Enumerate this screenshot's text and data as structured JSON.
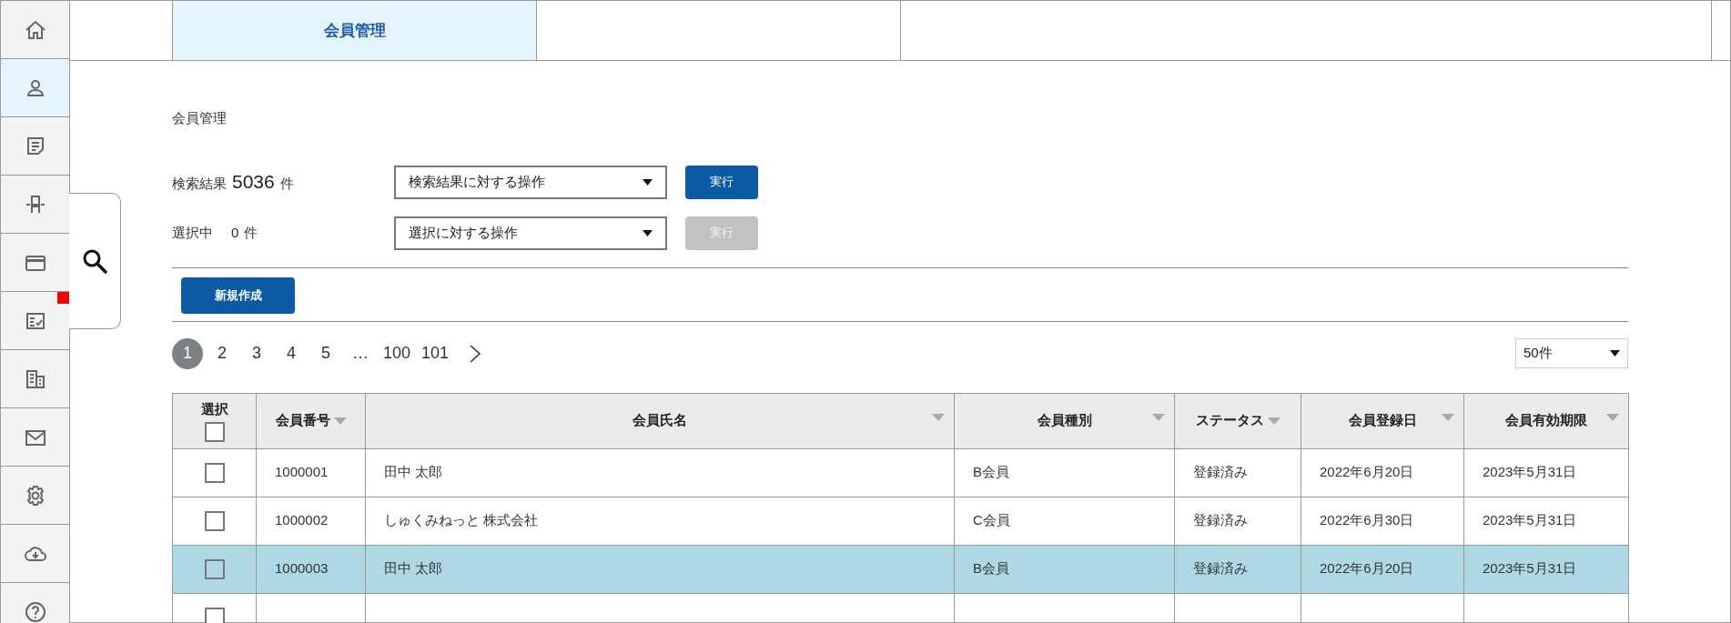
{
  "sidebar": {
    "items": [
      {
        "selected": false,
        "alert": false
      },
      {
        "selected": true,
        "alert": false
      },
      {
        "selected": false,
        "alert": false
      },
      {
        "selected": false,
        "alert": false
      },
      {
        "selected": false,
        "alert": false
      },
      {
        "selected": false,
        "alert": true
      },
      {
        "selected": false,
        "alert": false
      },
      {
        "selected": false,
        "alert": false
      },
      {
        "selected": false,
        "alert": false
      },
      {
        "selected": false,
        "alert": false
      },
      {
        "selected": false,
        "alert": false
      }
    ]
  },
  "tabs": [
    {
      "label": "会員管理",
      "selected": true
    },
    {
      "selected": false
    }
  ],
  "page_title": "会員管理",
  "search_result": {
    "label": "検索結果",
    "count": "5036",
    "unit": "件",
    "operation": "検索結果に対する操作",
    "button": {
      "label": "実行",
      "disabled": false
    }
  },
  "selection": {
    "label": "選択中",
    "count": "0",
    "unit": "件",
    "operation": "選択に対する操作",
    "button": {
      "label": "実行",
      "disabled": true
    }
  },
  "new_button": "新規作成",
  "pagination": {
    "pages": [
      {
        "label": "1",
        "selected": true
      },
      {
        "label": "2",
        "selected": false
      },
      {
        "label": "3",
        "selected": false
      },
      {
        "label": "4",
        "selected": false
      },
      {
        "label": "5",
        "selected": false
      },
      {
        "label": "…",
        "selected": false
      },
      {
        "label": "100",
        "selected": false
      },
      {
        "label": "101",
        "selected": false
      }
    ]
  },
  "page_size": "50件",
  "table": {
    "columns": [
      {
        "label": "選択",
        "sortable": false
      },
      {
        "label": "会員番号",
        "sortable": true
      },
      {
        "label": "会員氏名",
        "sortable": true
      },
      {
        "label": "会員種別",
        "sortable": true
      },
      {
        "label": "ステータス",
        "sortable": true
      },
      {
        "label": "会員登録日",
        "sortable": true
      },
      {
        "label": "会員有効期限",
        "sortable": true
      }
    ],
    "header_checked": false,
    "rows": [
      {
        "selected": false,
        "checked": false,
        "cells": [
          "1000001",
          "田中 太郎",
          "B会員",
          "登録済み",
          "2022年6月20日",
          "2023年5月31日"
        ]
      },
      {
        "selected": false,
        "checked": false,
        "cells": [
          "1000002",
          "しゅくみねっと 株式会社",
          "C会員",
          "登録済み",
          "2022年6月30日",
          "2023年5月31日"
        ]
      },
      {
        "selected": true,
        "checked": false,
        "cells": [
          "1000003",
          "田中 太郎",
          "B会員",
          "登録済み",
          "2022年6月20日",
          "2023年5月31日"
        ]
      },
      {
        "selected": false,
        "checked": false
      }
    ]
  }
}
